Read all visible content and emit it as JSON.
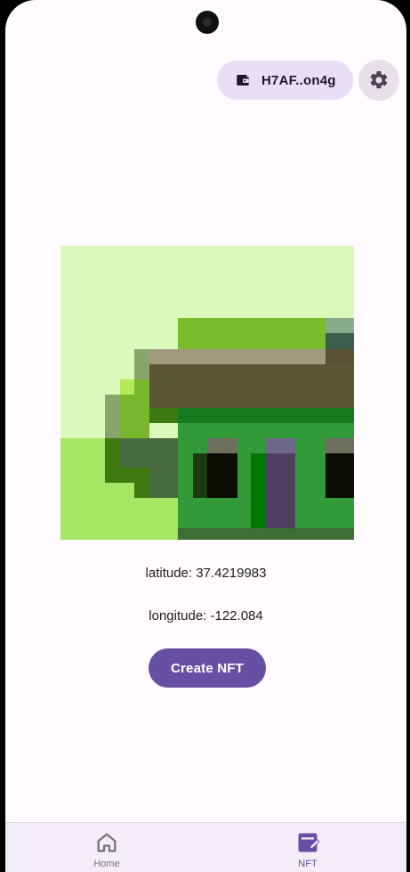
{
  "header": {
    "wallet_label": "H7AF..on4g",
    "wallet_icon": "wallet-icon",
    "settings_icon": "gear-icon"
  },
  "nft": {
    "image_semantic": "pixel-art-house",
    "latitude_text": "latitude: 37.4219983",
    "longitude_text": "longitude: -122.084",
    "create_label": "Create NFT"
  },
  "nav": {
    "items": [
      {
        "label": "Home",
        "icon": "home-icon",
        "selected": false
      },
      {
        "label": "NFT",
        "icon": "nft-edit-icon",
        "selected": true
      }
    ]
  },
  "colors": {
    "primary": "#6750a4",
    "chip": "#e8def8",
    "surface": "#fffbfe"
  }
}
